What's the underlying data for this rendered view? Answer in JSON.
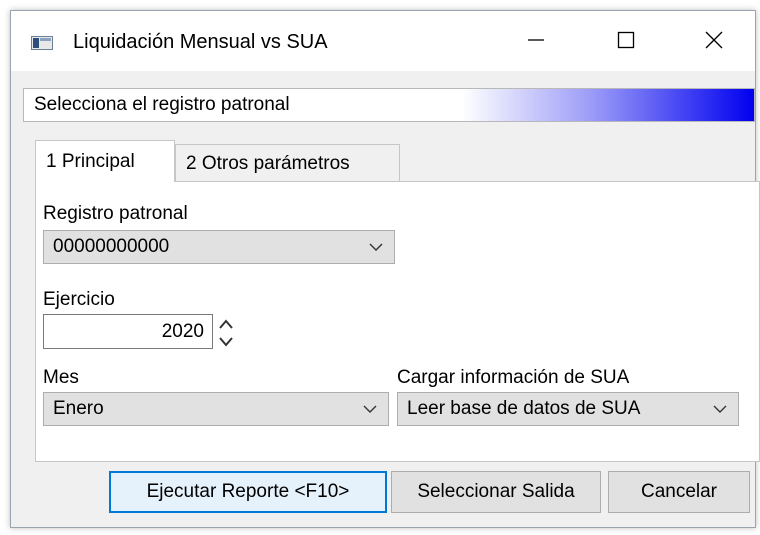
{
  "window": {
    "title": "Liquidación Mensual vs SUA",
    "icon": "app-window-icon",
    "controls": [
      "minimize-icon",
      "maximize-icon",
      "close-icon"
    ]
  },
  "banner": {
    "text": "Selecciona el registro patronal",
    "gradient_colors": [
      "#ffffff",
      "#0000f0"
    ]
  },
  "tabs": [
    {
      "label": "1 Principal",
      "active": true
    },
    {
      "label": "2 Otros parámetros",
      "active": false
    }
  ],
  "form": {
    "registro_patronal": {
      "label": "Registro patronal",
      "value": "00000000000"
    },
    "ejercicio": {
      "label": "Ejercicio",
      "value": "2020"
    },
    "mes": {
      "label": "Mes",
      "value": "Enero"
    },
    "cargar_sua": {
      "label": "Cargar información de SUA",
      "value": "Leer base de datos de SUA"
    }
  },
  "buttons": {
    "run": "Ejecutar Reporte <F10>",
    "output": "Seleccionar Salida",
    "cancel": "Cancelar"
  },
  "colors": {
    "accent": "#0078d7",
    "window_bg": "#f0f0f0",
    "control_bg": "#e1e1e1"
  }
}
